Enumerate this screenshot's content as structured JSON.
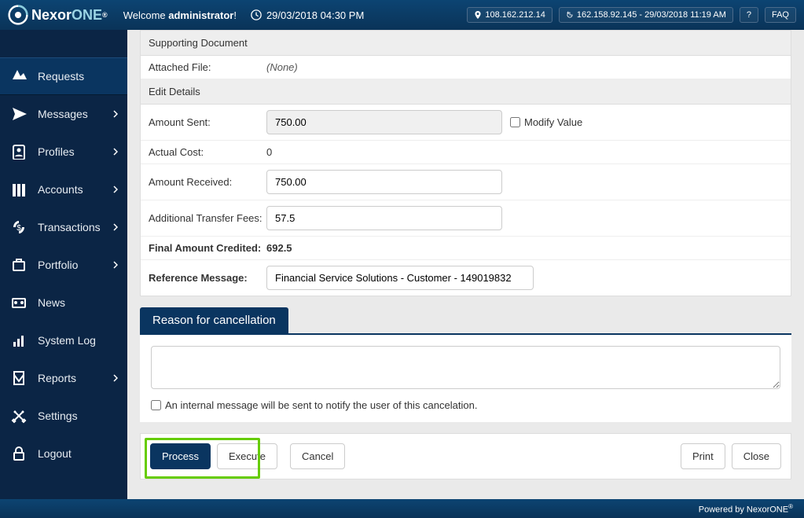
{
  "header": {
    "brand_main": "Nexor",
    "brand_accent": "ONE",
    "reg": "®",
    "welcome_prefix": "Welcome ",
    "welcome_user": "administrator",
    "welcome_suffix": "!",
    "datetime": "29/03/2018 04:30 PM",
    "ip_current": "108.162.212.14",
    "ip_history": "162.158.92.145 - 29/03/2018 11:19 AM",
    "help": "?",
    "faq": "FAQ"
  },
  "sidebar": [
    {
      "label": "Requests",
      "arrow": false,
      "active": true,
      "icon": "requests"
    },
    {
      "label": "Messages",
      "arrow": true,
      "active": false,
      "icon": "messages"
    },
    {
      "label": "Profiles",
      "arrow": true,
      "active": false,
      "icon": "profiles"
    },
    {
      "label": "Accounts",
      "arrow": true,
      "active": false,
      "icon": "accounts"
    },
    {
      "label": "Transactions",
      "arrow": true,
      "active": false,
      "icon": "transactions"
    },
    {
      "label": "Portfolio",
      "arrow": true,
      "active": false,
      "icon": "portfolio"
    },
    {
      "label": "News",
      "arrow": false,
      "active": false,
      "icon": "news"
    },
    {
      "label": "System Log",
      "arrow": false,
      "active": false,
      "icon": "systemlog"
    },
    {
      "label": "Reports",
      "arrow": true,
      "active": false,
      "icon": "reports"
    },
    {
      "label": "Settings",
      "arrow": false,
      "active": false,
      "icon": "settings"
    },
    {
      "label": "Logout",
      "arrow": false,
      "active": false,
      "icon": "logout"
    }
  ],
  "sections": {
    "supporting_doc": "Supporting Document",
    "attached_file_label": "Attached File:",
    "attached_file_value": "(None)",
    "edit_details": "Edit Details",
    "amount_sent_label": "Amount Sent:",
    "amount_sent_value": "750.00",
    "modify_value_label": "Modify Value",
    "actual_cost_label": "Actual Cost:",
    "actual_cost_value": "0",
    "amount_received_label": "Amount Received:",
    "amount_received_value": "750.00",
    "addl_fees_label": "Additional Transfer Fees:",
    "addl_fees_value": "57.5",
    "final_credited_label": "Final Amount Credited:",
    "final_credited_value": "692.5",
    "ref_message_label": "Reference Message:",
    "ref_message_value": "Financial Service Solutions - Customer - 149019832"
  },
  "reason": {
    "title": "Reason for cancellation",
    "textarea_value": "",
    "notify_label": "An internal message will be sent to notify the user of this cancelation."
  },
  "buttons": {
    "process": "Process",
    "execute": "Execute",
    "cancel": "Cancel",
    "print": "Print",
    "close": "Close"
  },
  "footer": {
    "text": "Powered by NexorONE",
    "reg": "®"
  }
}
